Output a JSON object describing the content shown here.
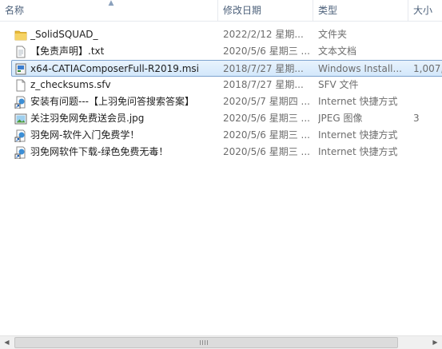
{
  "columns": {
    "name": "名称",
    "date": "修改日期",
    "type": "类型",
    "size": "大小"
  },
  "files": [
    {
      "name": "_SolidSQUAD_",
      "date": "2022/2/12 星期...",
      "type": "文件夹",
      "size": "",
      "icon": "folder-icon"
    },
    {
      "name": "【免责声明】.txt",
      "date": "2020/5/6 星期三 ...",
      "type": "文本文档",
      "size": "",
      "icon": "text-file-icon"
    },
    {
      "name": "x64-CATIAComposerFull-R2019.msi",
      "date": "2018/7/27 星期...",
      "type": "Windows Install...",
      "size": "1,007,",
      "icon": "msi-installer-icon",
      "selected": true
    },
    {
      "name": "z_checksums.sfv",
      "date": "2018/7/27 星期...",
      "type": "SFV 文件",
      "size": "",
      "icon": "blank-file-icon"
    },
    {
      "name": "安装有问题---【上羽免问答搜索答案】",
      "date": "2020/5/7 星期四 ...",
      "type": "Internet 快捷方式",
      "size": "",
      "icon": "internet-shortcut-icon"
    },
    {
      "name": "关注羽免网免费送会员.jpg",
      "date": "2020/5/6 星期三 ...",
      "type": "JPEG 图像",
      "size": "3",
      "icon": "image-file-icon"
    },
    {
      "name": "羽免网-软件入门免费学！",
      "date": "2020/5/6 星期三 ...",
      "type": "Internet 快捷方式",
      "size": "",
      "icon": "internet-shortcut-icon"
    },
    {
      "name": "羽免网软件下载-绿色免费无毒！",
      "date": "2020/5/6 星期三 ...",
      "type": "Internet 快捷方式",
      "size": "",
      "icon": "internet-shortcut-icon"
    }
  ],
  "colors": {
    "header_text": "#4c607a",
    "selection_border": "#7da2ce",
    "secondary_text": "#6d6d6d"
  }
}
